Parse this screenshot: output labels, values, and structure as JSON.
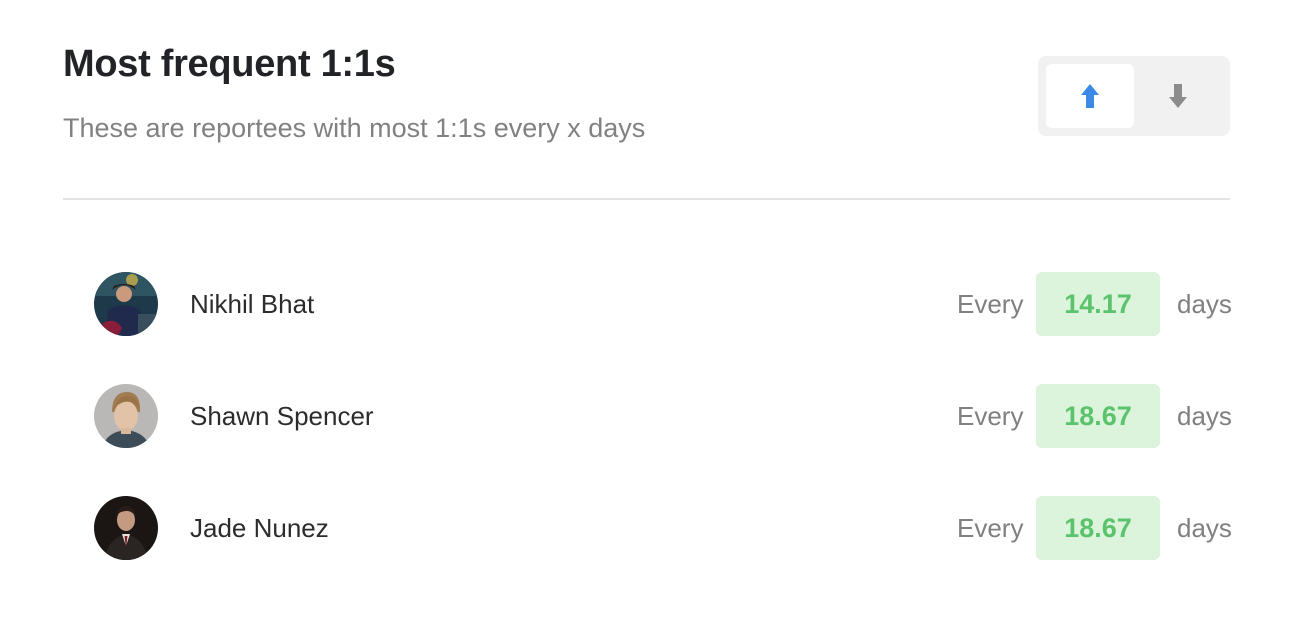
{
  "header": {
    "title": "Most frequent 1:1s",
    "subtitle": "These are reportees with most 1:1s every x days"
  },
  "sort": {
    "ascending_icon": "arrow-up-icon",
    "descending_icon": "arrow-down-icon",
    "active": "ascending",
    "active_color": "#3b8be6",
    "inactive_color": "#8c8c8c"
  },
  "reportees": [
    {
      "name": "Nikhil Bhat",
      "every_label": "Every",
      "value": "14.17",
      "unit": "days"
    },
    {
      "name": "Shawn Spencer",
      "every_label": "Every",
      "value": "18.67",
      "unit": "days"
    },
    {
      "name": "Jade Nunez",
      "every_label": "Every",
      "value": "18.67",
      "unit": "days"
    }
  ],
  "colors": {
    "value_badge_bg": "#dcf3dc",
    "value_text": "#5cc36d"
  }
}
